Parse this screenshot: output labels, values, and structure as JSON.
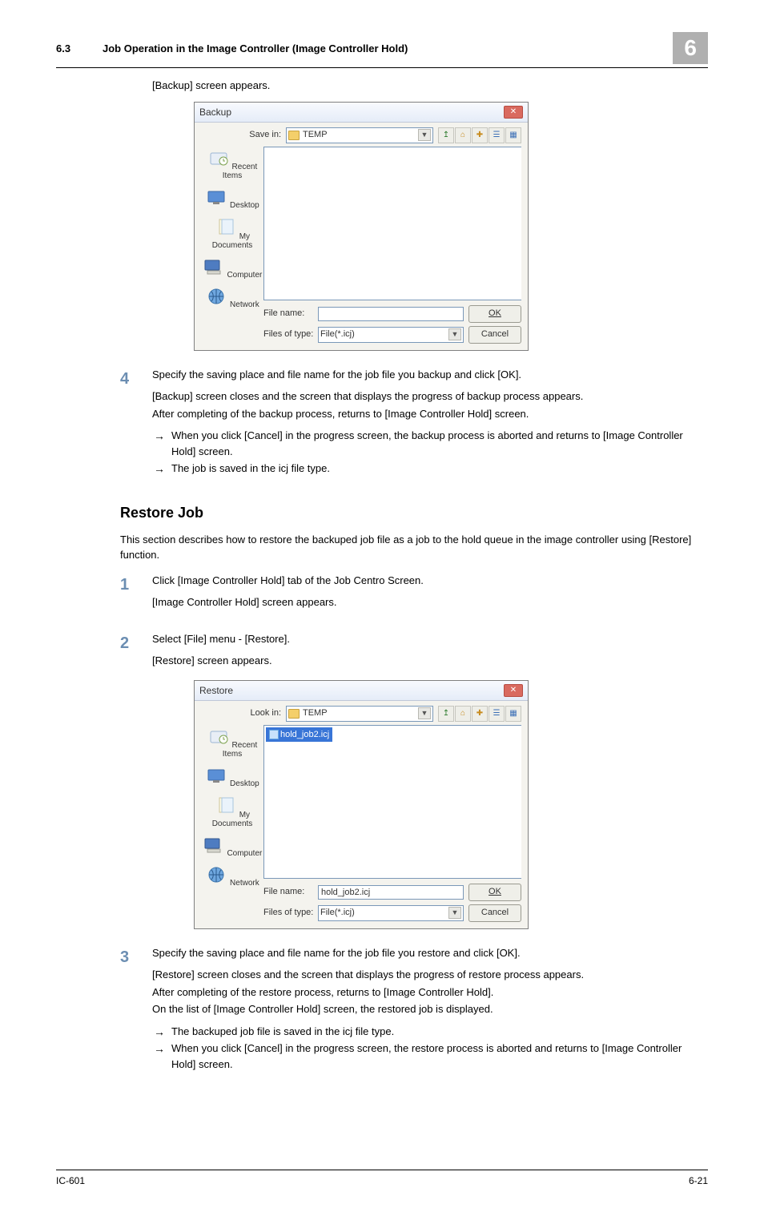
{
  "header": {
    "section_number": "6.3",
    "section_title": "Job Operation in the Image Controller (Image Controller Hold)",
    "chapter": "6"
  },
  "intro_backup_appears": "[Backup] screen appears.",
  "dialog_backup": {
    "title": "Backup",
    "close": "✕",
    "save_in_label": "Save in:",
    "folder_name": "TEMP",
    "places": [
      "Recent Items",
      "Desktop",
      "My\nDocuments",
      "Computer",
      "Network"
    ],
    "file_name_label": "File name:",
    "file_name_value": "",
    "file_type_label": "Files of type:",
    "file_type_value": "File(*.icj)",
    "ok": "OK",
    "cancel": "Cancel"
  },
  "step4": {
    "num": "4",
    "lead": "Specify the saving place and file name for the job file you backup and click [OK].",
    "l1": "[Backup] screen closes and the screen that displays the progress of backup process appears.",
    "l2": "After completing of the backup process, returns to [Image Controller Hold] screen.",
    "b1": "When you click [Cancel] in the progress screen, the backup process is aborted and returns to [Image Controller Hold] screen.",
    "b2": "The job is saved in the icj file type."
  },
  "restore": {
    "heading": "Restore Job",
    "intro": "This section describes how to restore the backuped job file as a job to the hold queue in the image controller using [Restore] function."
  },
  "step1": {
    "num": "1",
    "lead": "Click [Image Controller Hold] tab of the Job Centro Screen.",
    "sub": "[Image Controller Hold] screen appears."
  },
  "step2": {
    "num": "2",
    "lead": "Select [File] menu - [Restore].",
    "sub": "[Restore] screen appears."
  },
  "dialog_restore": {
    "title": "Restore",
    "close": "✕",
    "look_in_label": "Look in:",
    "folder_name": "TEMP",
    "file_item": "hold_job2.icj",
    "places": [
      "Recent Items",
      "Desktop",
      "My\nDocuments",
      "Computer",
      "Network"
    ],
    "file_name_label": "File name:",
    "file_name_value": "hold_job2.icj",
    "file_type_label": "Files of type:",
    "file_type_value": "File(*.icj)",
    "ok": "OK",
    "cancel": "Cancel"
  },
  "step3": {
    "num": "3",
    "lead": "Specify the saving place and file name for the job file you restore and click [OK].",
    "l1": "[Restore] screen closes and the screen that displays the progress of restore process appears.",
    "l2": "After completing of the restore process, returns to [Image Controller Hold].",
    "l3": "On the list of [Image Controller Hold] screen, the restored job is displayed.",
    "b1": "The backuped job file is saved in the icj file type.",
    "b2": "When you click [Cancel] in the progress screen, the restore process is aborted and returns to [Image Controller Hold] screen."
  },
  "footer": {
    "left": "IC-601",
    "right": "6-21"
  }
}
